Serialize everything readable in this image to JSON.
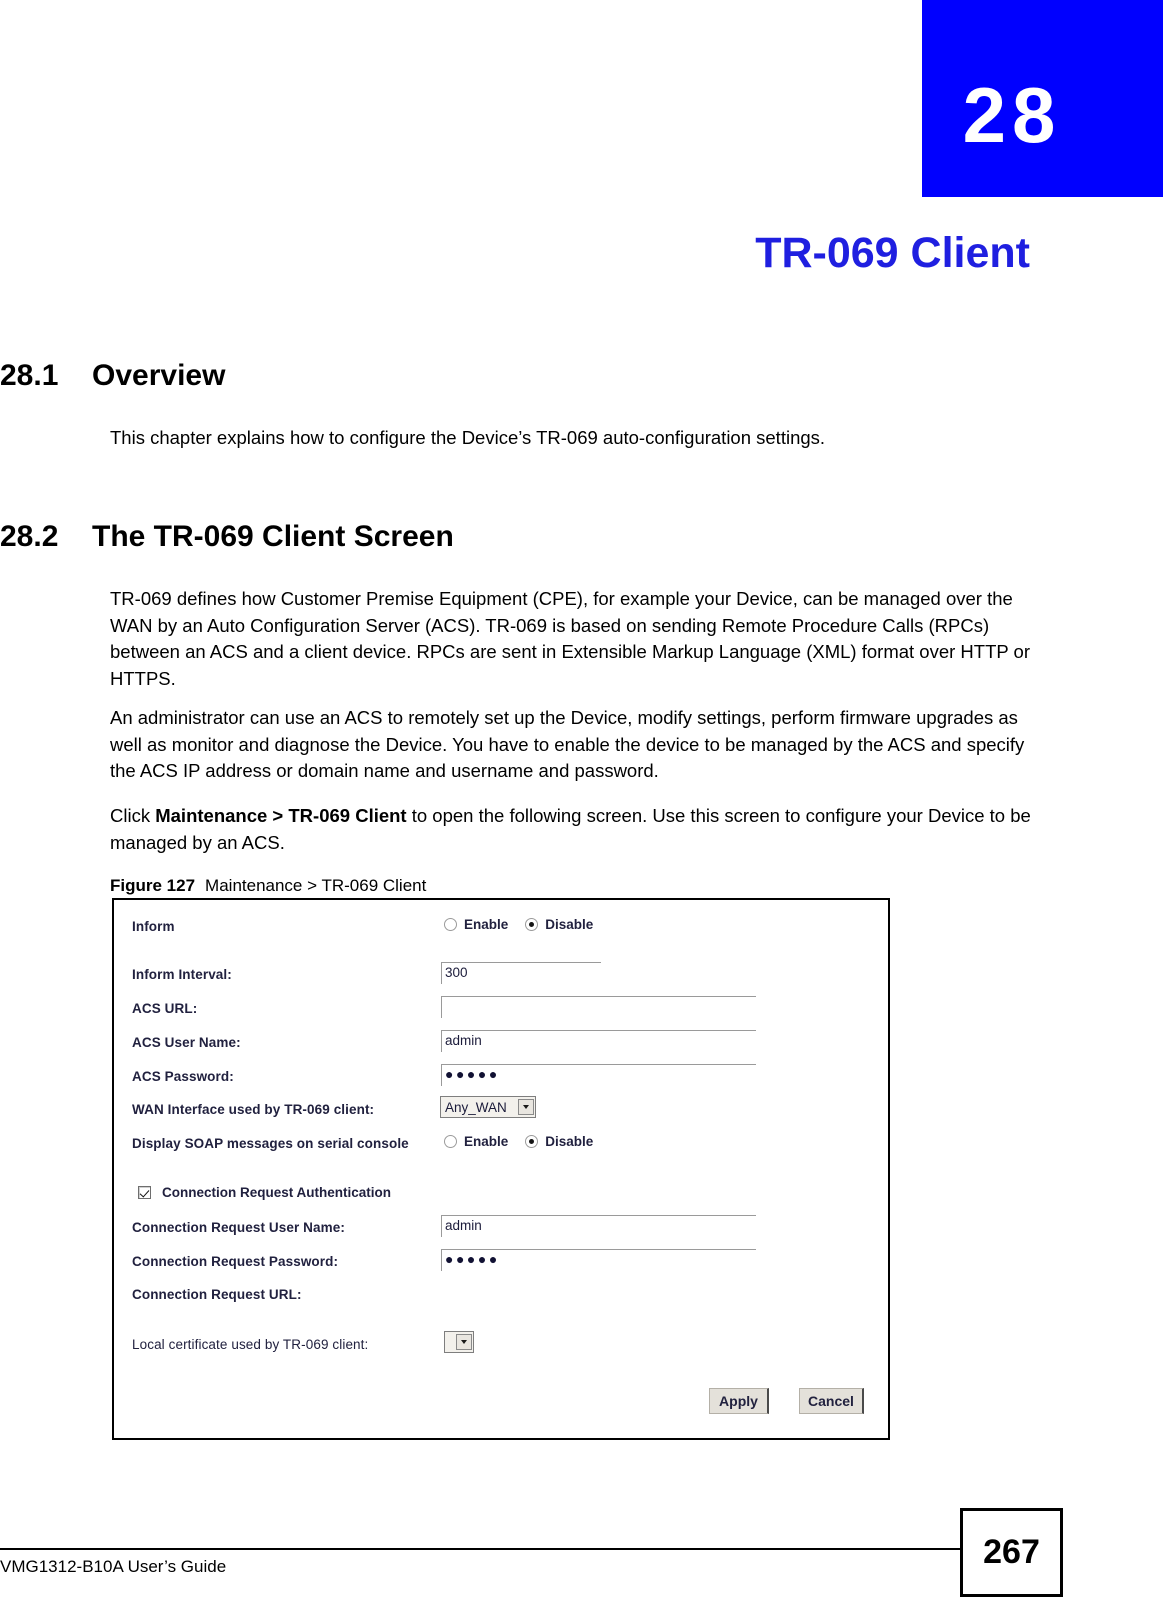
{
  "chapter": {
    "number": "28",
    "title": "TR-069 Client"
  },
  "sections": [
    {
      "number": "28.1",
      "heading": "Overview",
      "paragraphs": [
        "This chapter explains how to configure the Device’s TR-069 auto-configuration settings."
      ]
    },
    {
      "number": "28.2",
      "heading": "The TR-069 Client Screen",
      "paragraphs": [
        "TR-069 defines how Customer Premise Equipment (CPE), for example your Device, can be managed over the WAN by an Auto Configuration Server (ACS). TR-069 is based on sending Remote Procedure Calls (RPCs) between an ACS and a client device. RPCs are sent in Extensible Markup Language (XML) format over HTTP or HTTPS.",
        "An administrator can use an ACS to remotely set up the Device, modify settings, perform firmware upgrades as well as monitor and diagnose the Device. You have to enable the device to be managed by the ACS and specify the ACS IP address or domain name and username and password."
      ],
      "click_paragraph": {
        "prefix": "Click ",
        "bold": "Maintenance > TR-069 Client",
        "suffix": " to open the following screen. Use this screen to configure your Device to be managed by an ACS."
      }
    }
  ],
  "figure": {
    "label": "Figure 127",
    "caption": "Maintenance > TR-069 Client"
  },
  "screen": {
    "rows": {
      "inform": {
        "label": "Inform",
        "options": [
          "Enable",
          "Disable"
        ],
        "selected": "Disable"
      },
      "inform_interval": {
        "label": "Inform Interval:",
        "value": "300"
      },
      "acs_url": {
        "label": "ACS URL:",
        "value": ""
      },
      "acs_user_name": {
        "label": "ACS User Name:",
        "value": "admin"
      },
      "acs_password": {
        "label": "ACS Password:",
        "value": "●●●●●"
      },
      "wan_interface": {
        "label": "WAN Interface used by TR-069 client:",
        "value": "Any_WAN"
      },
      "display_soap": {
        "label": "Display SOAP messages on serial console",
        "options": [
          "Enable",
          "Disable"
        ],
        "selected": "Disable"
      },
      "conn_req_auth": {
        "label": "Connection Request Authentication",
        "checked": true
      },
      "conn_req_user_name": {
        "label": "Connection Request User Name:",
        "value": "admin"
      },
      "conn_req_password": {
        "label": "Connection Request Password:",
        "value": "●●●●●"
      },
      "conn_req_url": {
        "label": "Connection Request URL:",
        "value": ""
      },
      "local_certificate": {
        "label": "Local certificate used by TR-069 client:",
        "value": ""
      }
    },
    "buttons": {
      "apply": "Apply",
      "cancel": "Cancel"
    }
  },
  "footer": {
    "guide": "VMG1312-B10A User’s Guide",
    "page_number": "267"
  },
  "colors": {
    "chapter_tab": "#0000ff",
    "chapter_title": "#1f1fe0",
    "ui_text": "#21213f"
  }
}
